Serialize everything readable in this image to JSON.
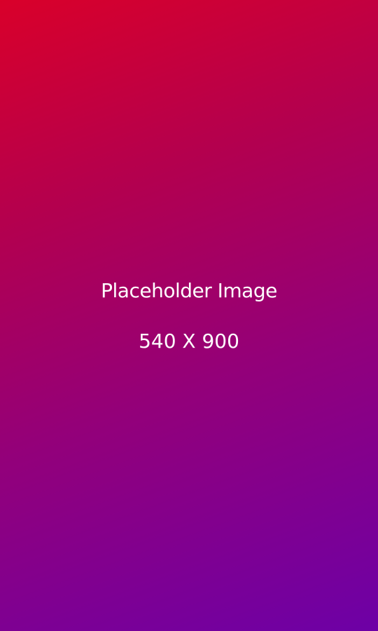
{
  "placeholder": {
    "title": "Placeholder Image",
    "dimensions": "540 X 900"
  },
  "colors": {
    "gradient_start": "#d9002a",
    "gradient_end": "#6d00a6",
    "text": "#ffffff"
  }
}
